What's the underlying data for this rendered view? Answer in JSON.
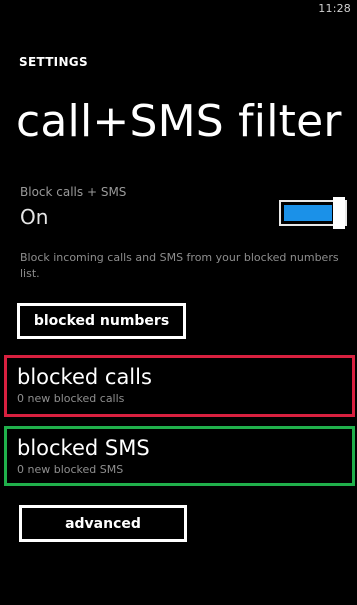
{
  "status_bar": {
    "time": "11:28"
  },
  "header": {
    "section_label": "SETTINGS",
    "title": "call+SMS filter"
  },
  "block_toggle": {
    "label": "Block calls + SMS",
    "state": "On",
    "enabled": true,
    "accent_color": "#1b91e8",
    "description": "Block incoming calls and SMS from your blocked numbers list."
  },
  "buttons": {
    "blocked_numbers": "blocked numbers",
    "advanced": "advanced"
  },
  "list": {
    "blocked_calls": {
      "title": "blocked calls",
      "subtitle": "0 new blocked calls",
      "highlight_color": "#d7203f"
    },
    "blocked_sms": {
      "title": "blocked SMS",
      "subtitle": "0 new blocked SMS",
      "highlight_color": "#20b04b"
    }
  }
}
